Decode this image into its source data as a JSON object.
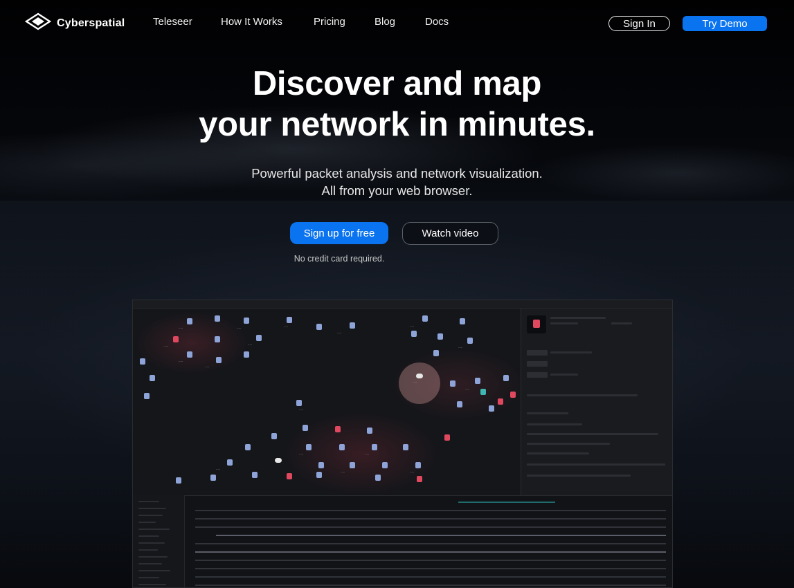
{
  "nav": {
    "brand": "Cyberspatial",
    "links": [
      {
        "label": "Teleseer"
      },
      {
        "label": "How It Works"
      },
      {
        "label": "Pricing"
      },
      {
        "label": "Blog"
      },
      {
        "label": "Docs"
      }
    ],
    "sign_in": "Sign In",
    "try_demo": "Try Demo"
  },
  "hero": {
    "headline_line1": "Discover and map",
    "headline_line2": "your network in minutes.",
    "subtitle_line1": "Powerful packet analysis and network visualization.",
    "subtitle_line2": "All from your web browser.",
    "primary_cta": "Sign up for free",
    "secondary_cta": "Watch video",
    "note": "No credit card required."
  },
  "colors": {
    "accent": "#0a73f0",
    "background": "#000000"
  },
  "icons": {
    "logo": "cyberspatial-logo-icon"
  }
}
